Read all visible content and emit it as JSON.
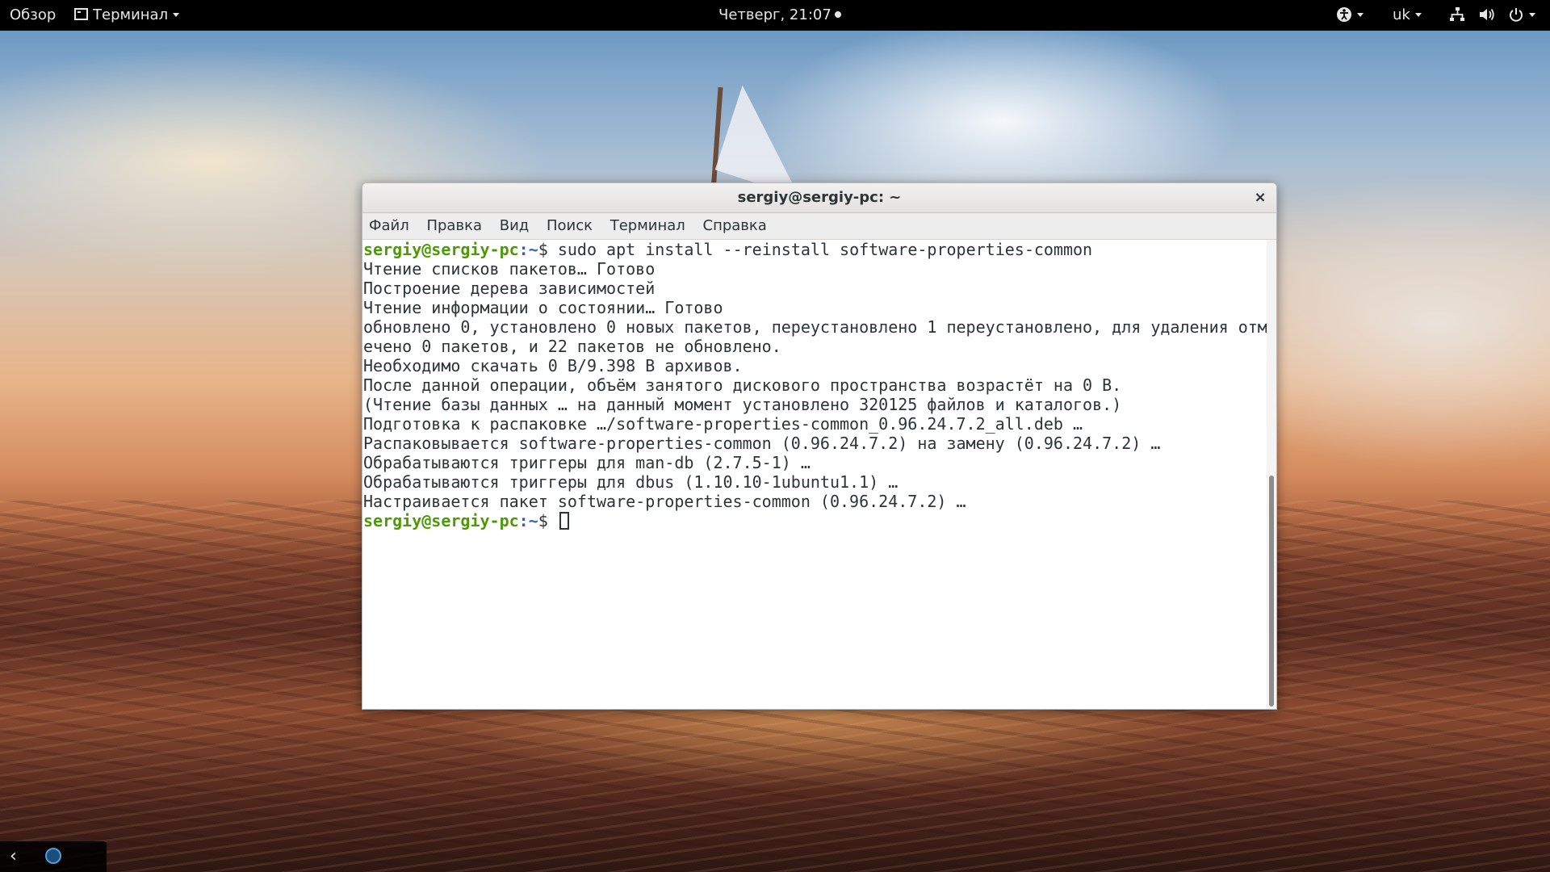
{
  "topbar": {
    "activities": "Обзор",
    "app_menu": "Терминал",
    "clock": "Четверг, 21:07",
    "language": "uk",
    "icons": {
      "accessibility": "accessibility-icon",
      "network": "network-icon",
      "volume": "volume-icon",
      "power": "power-icon"
    }
  },
  "window": {
    "title": "sergiy@sergiy-pc: ~",
    "close": "×"
  },
  "menubar": {
    "items": [
      "Файл",
      "Правка",
      "Вид",
      "Поиск",
      "Терминал",
      "Справка"
    ]
  },
  "terminal": {
    "prompt_user": "sergiy@sergiy-pc",
    "prompt_path": ":~",
    "prompt_symbol": "$ ",
    "command": "sudo apt install --reinstall software-properties-common",
    "output": [
      "Чтение списков пакетов… Готово",
      "Построение дерева зависимостей",
      "Чтение информации о состоянии… Готово",
      "обновлено 0, установлено 0 новых пакетов, переустановлено 1 переустановлено, для удаления отм",
      "ечено 0 пакетов, и 22 пакетов не обновлено.",
      "Необходимо скачать 0 B/9.398 B архивов.",
      "После данной операции, объём занятого дискового пространства возрастёт на 0 B.",
      "(Чтение базы данных … на данный момент установлено 320125 файлов и каталогов.)",
      "Подготовка к распаковке …/software-properties-common_0.96.24.7.2_all.deb …",
      "Распаковывается software-properties-common (0.96.24.7.2) на замену (0.96.24.7.2) …",
      "Обрабатываются триггеры для man-db (2.7.5-1) …",
      "Обрабатываются триггеры для dbus (1.10.10-1ubuntu1.1) …",
      "Настраивается пакет software-properties-common (0.96.24.7.2) …"
    ]
  },
  "bottom_tray": {
    "back": "‹"
  },
  "colors": {
    "prompt_user": "#4e9a06",
    "prompt_path": "#3465a4",
    "topbar": "#000000"
  }
}
